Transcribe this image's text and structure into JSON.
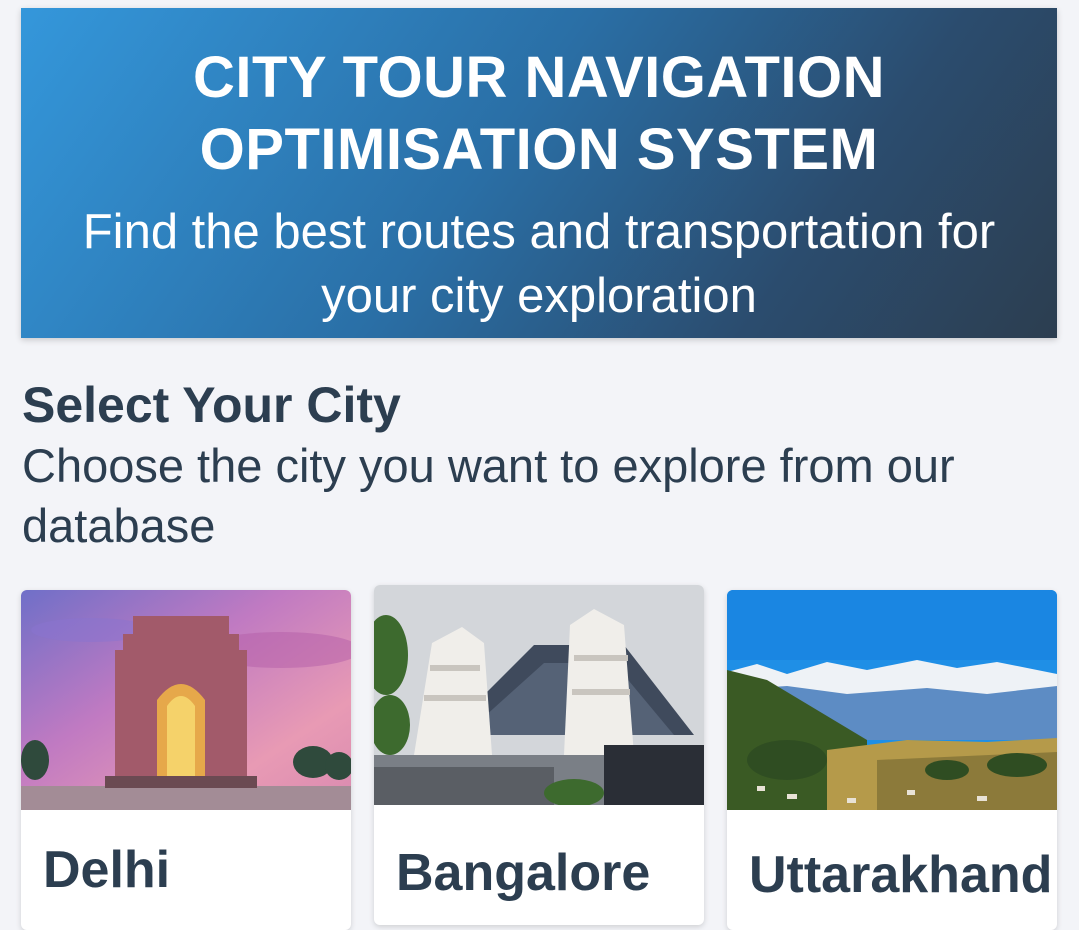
{
  "header": {
    "title": "CITY TOUR NAVIGATION OPTIMISATION SYSTEM",
    "subtitle": "Find the best routes and transportation for your city exploration"
  },
  "section": {
    "title": "Select Your City",
    "subtitle": "Choose the city you want to explore from our database"
  },
  "cities": [
    {
      "name": "Delhi",
      "image": "india-gate-photo"
    },
    {
      "name": "Bangalore",
      "image": "iskcon-temple-photo"
    },
    {
      "name": "Uttarakhand",
      "image": "himalaya-mountains-photo"
    }
  ],
  "colors": {
    "hero_start": "#3497db",
    "hero_end": "#2c3e50",
    "text_dark": "#2c3e50",
    "page_bg": "#f3f4f8"
  }
}
